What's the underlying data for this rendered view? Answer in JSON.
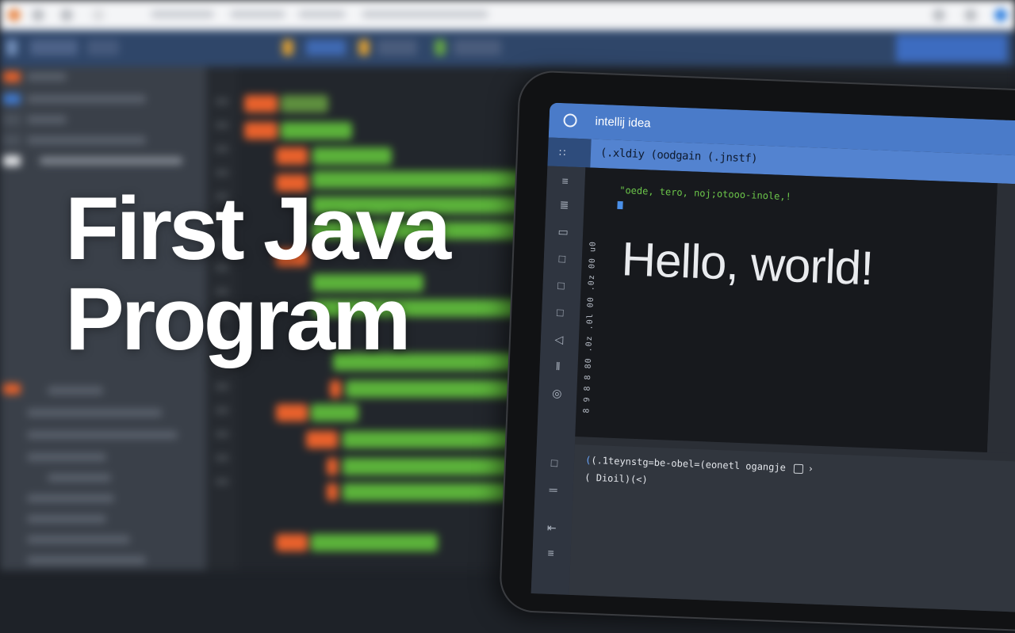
{
  "video_title": {
    "line1": "First Java",
    "line2": "Program"
  },
  "ide_window": {
    "app_name": "intellij idea",
    "tab_title": "(.xldiy (oodgain (.jnstf)",
    "code_comment": "\"oede, tero, noj;otooo-inole,!",
    "gutter_text": "8 9 8 8 80 .0z .0l 00 .0z 00 u0",
    "output_text": "Hello, world!",
    "console_line1": "(.1teynstg=be-obel=(eonetl ogangje",
    "console_line2": "(  Dioil)(<)"
  },
  "colors": {
    "header_blue": "#4a7bc9",
    "tab_blue": "#5383d0",
    "keyword_orange": "#e8612c",
    "string_green": "#5bb23a"
  }
}
